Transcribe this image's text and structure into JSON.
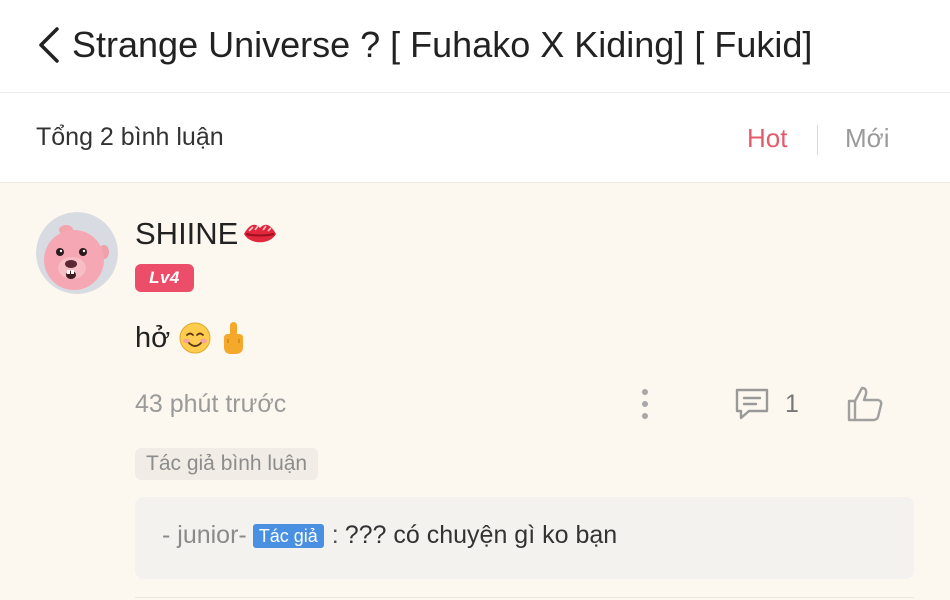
{
  "header": {
    "title": "Strange Universe ? [ Fuhako X Kiding] [ Fukid]",
    "back_icon": "chevron-left-icon"
  },
  "comments_bar": {
    "count_label": "Tổng 2 bình luận",
    "sort_hot": "Hot",
    "sort_new": "Mới",
    "active_sort": "Hot",
    "accent_color": "#e45b6c"
  },
  "comment": {
    "username": "SHIINE",
    "username_emoji": "lips-icon",
    "level": "Lv4",
    "level_color": "#ec4e6a",
    "text": "hở",
    "content_emojis": [
      "smiling-face-icon",
      "middle-finger-icon"
    ],
    "time": "43 phút trước",
    "reply_count": "1",
    "author_tag": "Tác giả bình luận",
    "reply": {
      "user": "- junior-",
      "badge": "Tác giả",
      "badge_color": "#4a90e2",
      "separator": ":",
      "text": "??? có chuyện gì ko bạn"
    }
  }
}
